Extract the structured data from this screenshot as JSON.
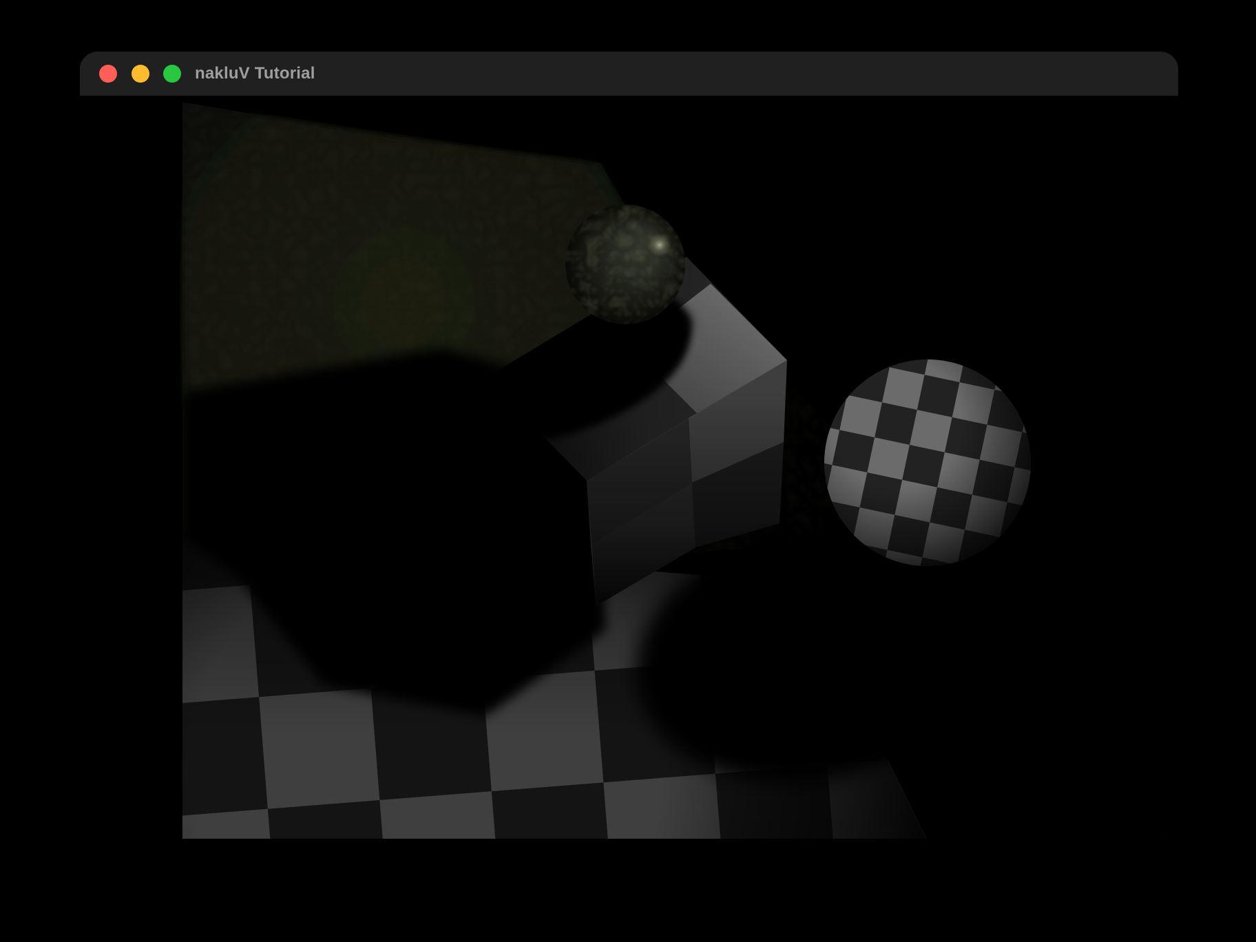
{
  "window": {
    "title": "nakluV Tutorial",
    "traffic_lights": {
      "close": {
        "label": "close",
        "color": "#ff5f57"
      },
      "minimize": {
        "label": "minimize",
        "color": "#febc2e"
      },
      "zoom": {
        "label": "zoom",
        "color": "#28c840"
      }
    }
  },
  "viewport": {
    "background": "#000000",
    "scene_objects": {
      "floor": "cracked-stone-floor under spotlight",
      "carpet": "large checkered carpet",
      "cube": "checkered cube",
      "dark_sphere": "crackle-textured sphere resting on cube",
      "checker_sphere": "checkered sphere at right",
      "shadows": "hard black cast shadows"
    },
    "colors": {
      "carpet_light": "#3f3f3f",
      "carpet_dark": "#141414",
      "cube_top_light": "#6f6f6f",
      "cube_top_dark": "#282828",
      "cube_side_light": "#3e3e3e",
      "cube_side_dark": "#272727",
      "cube_side_light2": "#2c2c2c",
      "cube_side_dark2": "#1d1d1d",
      "sphere_checker_light": "#6b6b6b",
      "sphere_checker_dark": "#222222",
      "cracked_floor_tint": "#1b1c11",
      "dark_sphere_base": "#33362a",
      "shadow": "#000000"
    }
  }
}
